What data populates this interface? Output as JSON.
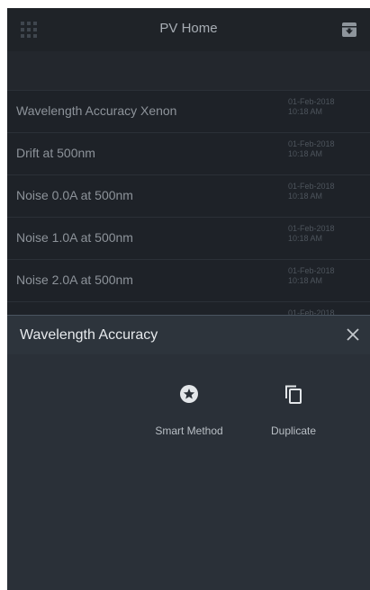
{
  "header": {
    "title": "PV Home",
    "menu_icon": "grid-icon",
    "archive_icon": "archive-icon"
  },
  "list": [
    {
      "title": "Wavelength Accuracy Xenon",
      "date": "01-Feb-2018",
      "time": "10:18 AM"
    },
    {
      "title": "Drift at 500nm",
      "date": "01-Feb-2018",
      "time": "10:18 AM"
    },
    {
      "title": "Noise 0.0A at 500nm",
      "date": "01-Feb-2018",
      "time": "10:18 AM"
    },
    {
      "title": "Noise 1.0A at 500nm",
      "date": "01-Feb-2018",
      "time": "10:18 AM"
    },
    {
      "title": "Noise 2.0A at 500nm",
      "date": "01-Feb-2018",
      "time": "10:18 AM"
    },
    {
      "title": "",
      "date": "01-Feb-2018",
      "time": ""
    }
  ],
  "sheet": {
    "title": "Wavelength Accuracy",
    "close_icon": "close-icon",
    "actions": [
      {
        "label": "Smart Method",
        "icon": "star-circle-icon"
      },
      {
        "label": "Duplicate",
        "icon": "copy-icon"
      }
    ]
  },
  "colors": {
    "background": "#1e2228",
    "sheet": "#2a3038",
    "text_primary": "#e6e9ec",
    "text_muted": "#8d939a"
  }
}
